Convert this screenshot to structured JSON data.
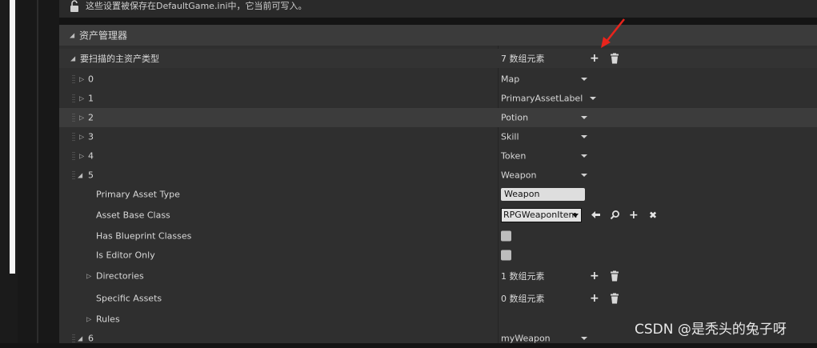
{
  "notice": {
    "text": "这些设置被保存在DefaultGame.ini中，它当前可写入。"
  },
  "category": {
    "title": "资产管理器"
  },
  "primary_asset_types": {
    "label": "要扫描的主资产类型",
    "count_text": "7 数组元素",
    "items": [
      {
        "index": "0",
        "value": "Map"
      },
      {
        "index": "1",
        "value": "PrimaryAssetLabel"
      },
      {
        "index": "2",
        "value": "Potion"
      },
      {
        "index": "3",
        "value": "Skill"
      },
      {
        "index": "4",
        "value": "Token"
      },
      {
        "index": "5",
        "value": "Weapon"
      },
      {
        "index": "6",
        "value": "myWeapon"
      }
    ]
  },
  "element5": {
    "primary_asset_type_label": "Primary Asset Type",
    "primary_asset_type_value": "Weapon",
    "asset_base_class_label": "Asset Base Class",
    "asset_base_class_value": "RPGWeaponItem",
    "has_blueprint_classes_label": "Has Blueprint Classes",
    "has_blueprint_classes_checked": false,
    "is_editor_only_label": "Is Editor Only",
    "is_editor_only_checked": false,
    "directories_label": "Directories",
    "directories_count": "1 数组元素",
    "specific_assets_label": "Specific Assets",
    "specific_assets_count": "0 数组元素",
    "rules_label": "Rules"
  },
  "icons": {
    "add": "+",
    "clear": "✖",
    "use_selected": "🡐",
    "browse": "⚲"
  },
  "colors": {
    "annotation_arrow": "#e8241c"
  },
  "watermark": "CSDN @是秃头的兔子呀"
}
